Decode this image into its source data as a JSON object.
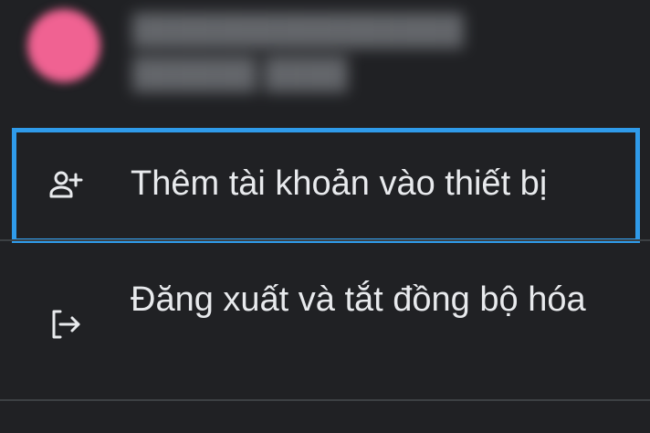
{
  "account": {
    "avatar_color": "#f06292",
    "name_email_redacted": "████████████████ ██████ ████"
  },
  "menu": {
    "add_account": {
      "label": "Thêm tài khoản vào thiết bị",
      "icon": "person-add-icon",
      "highlighted": true
    },
    "sign_out": {
      "label": "Đăng xuất và tắt đồng bộ hóa",
      "icon": "sign-out-icon"
    }
  },
  "colors": {
    "background": "#202124",
    "highlight": "#2f9bea",
    "text": "#e8eaed",
    "divider": "#3c4043"
  }
}
